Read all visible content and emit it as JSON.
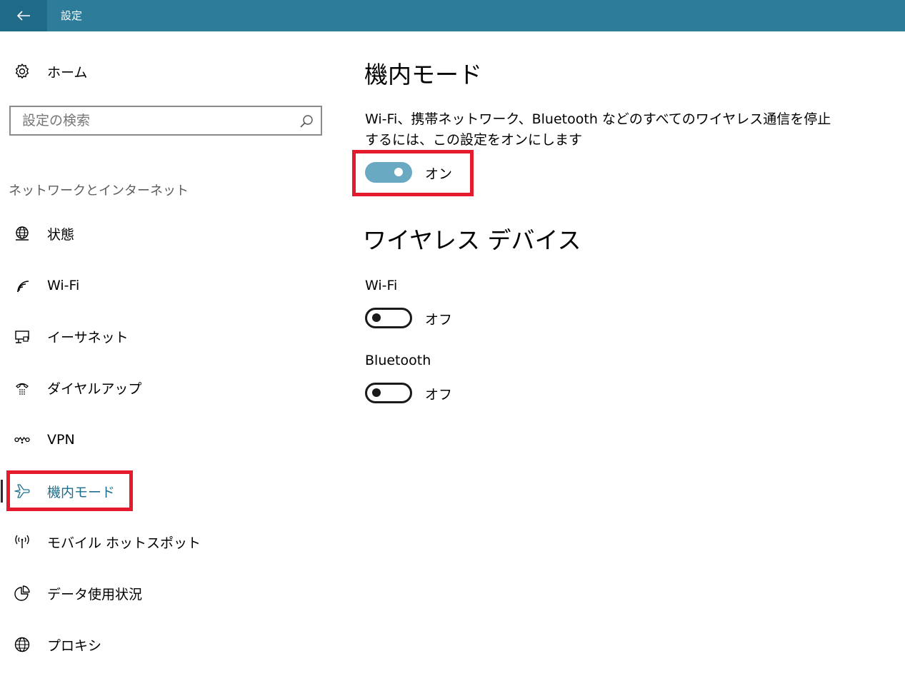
{
  "app": {
    "title": "設定"
  },
  "sidebar": {
    "home_label": "ホーム",
    "search_placeholder": "設定の検索",
    "section_title": "ネットワークとインターネット",
    "items": [
      {
        "label": "状態",
        "icon": "globe-status-icon"
      },
      {
        "label": "Wi-Fi",
        "icon": "wifi-icon"
      },
      {
        "label": "イーサネット",
        "icon": "ethernet-icon"
      },
      {
        "label": "ダイヤルアップ",
        "icon": "dialup-phone-icon"
      },
      {
        "label": "VPN",
        "icon": "vpn-icon"
      },
      {
        "label": "機内モード",
        "icon": "airplane-icon",
        "selected": true
      },
      {
        "label": "モバイル ホットスポット",
        "icon": "hotspot-icon"
      },
      {
        "label": "データ使用状況",
        "icon": "pie-chart-icon"
      },
      {
        "label": "プロキシ",
        "icon": "globe-icon"
      }
    ]
  },
  "main": {
    "title": "機内モード",
    "description": "Wi-Fi、携帯ネットワーク、Bluetooth などのすべてのワイヤレス通信を停止するには、この設定をオンにします",
    "airplane_toggle": {
      "state_label": "オン",
      "on": true
    },
    "wireless_heading": "ワイヤレス デバイス",
    "devices": [
      {
        "label": "Wi-Fi",
        "state_label": "オフ",
        "on": false
      },
      {
        "label": "Bluetooth",
        "state_label": "オフ",
        "on": false
      }
    ]
  },
  "colors": {
    "titlebar": "#2d7d9a",
    "accent": "#1d6f8d",
    "toggle_on": "#6aa9c2",
    "highlight_box": "#e31b2d"
  }
}
